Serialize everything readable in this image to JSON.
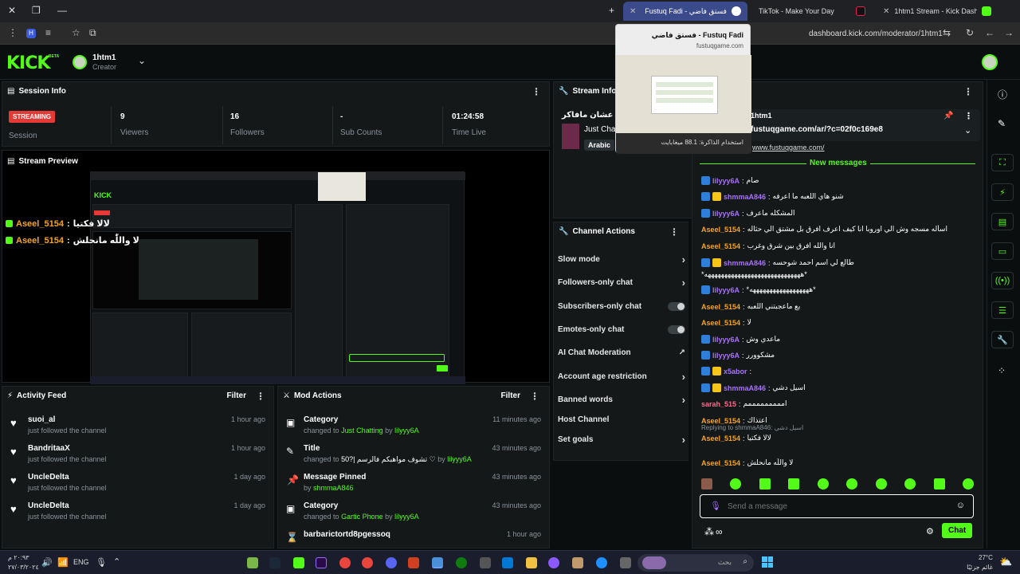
{
  "browser": {
    "tabs": [
      {
        "label": "فستق فاضي - Fustuq Fadi",
        "active": true
      },
      {
        "label": "TikTok - Make Your Day",
        "active": false
      },
      {
        "label": "1htm1 Stream - Kick Dashboard",
        "active": false
      }
    ],
    "url": "dashboard.kick.com/moderator/1htm1",
    "hover_card": {
      "title": "فستق فاضي - Fustuq Fadi",
      "domain": "fustuqgame.com",
      "memory": "استخدام الذاكرة: 88.1 ميغابايت"
    }
  },
  "header": {
    "logo": "KICK",
    "logo_beta": "BETA",
    "channel": "1htm1",
    "role": "Creator"
  },
  "session": {
    "title": "Session Info",
    "status": "STREAMING",
    "session_label": "Session",
    "stats": [
      {
        "value": "9",
        "label": "Viewers"
      },
      {
        "value": "16",
        "label": "Followers"
      },
      {
        "value": "-",
        "label": "Sub Counts"
      },
      {
        "value": "01:24:58",
        "label": "Time Live"
      }
    ]
  },
  "preview": {
    "title": "Stream Preview",
    "overlay": [
      {
        "user": "Aseel_5154",
        "text": "لالا فكتيا"
      },
      {
        "user": "Aseel_5154",
        "text": "لا واللّٰه مانحلش"
      }
    ]
  },
  "activity": {
    "title": "Activity Feed",
    "filter": "Filter",
    "items": [
      {
        "user": "suoi_al",
        "text": "just followed the channel",
        "time": "1 hour ago"
      },
      {
        "user": "BandritaaX",
        "text": "just followed the channel",
        "time": "1 hour ago"
      },
      {
        "user": "UncleDelta",
        "text": "just followed the channel",
        "time": "1 day ago"
      },
      {
        "user": "UncleDelta",
        "text": "just followed the channel",
        "time": "1 day ago"
      }
    ]
  },
  "mod": {
    "title": "Mod Actions",
    "filter": "Filter",
    "items": [
      {
        "action": "Category",
        "pre": "changed to",
        "target": "Just Chatting",
        "by": "by",
        "user": "lilyyy6A",
        "time": "11 minutes ago"
      },
      {
        "action": "Title",
        "pre": "changed to",
        "target": "50?| تشوف مواهبكم فالرسم ♡",
        "by": "by",
        "user": "lilyyy6A",
        "time": "43 minutes ago"
      },
      {
        "action": "Message Pinned",
        "pre": "",
        "target": "",
        "by": "by",
        "user": "shmmaA846",
        "time": "43 minutes ago"
      },
      {
        "action": "Category",
        "pre": "changed to",
        "target": "Gartic Phone",
        "by": "by",
        "user": "lilyyy6A",
        "time": "43 minutes ago"
      },
      {
        "action": "barbarictortd8pgessoq",
        "pre": "",
        "target": "",
        "by": "",
        "user": "",
        "time": "1 hour ago"
      }
    ]
  },
  "stream_info": {
    "title": "Stream Info",
    "stream_title": "ع وقت عشان مافاكر",
    "category": "Just Cha",
    "language": "Arabic"
  },
  "channel_actions": {
    "title": "Channel Actions",
    "items": [
      {
        "label": "Slow mode",
        "control": "chevron"
      },
      {
        "label": "Followers-only chat",
        "control": "chevron"
      },
      {
        "label": "Subscribers-only chat",
        "control": "toggle"
      },
      {
        "label": "Emotes-only chat",
        "control": "toggle"
      },
      {
        "label": "AI Chat Moderation",
        "control": "external"
      },
      {
        "label": "Account age restriction",
        "control": "chevron"
      },
      {
        "label": "Banned words",
        "control": "chevron"
      },
      {
        "label": "Host Channel",
        "control": "none"
      },
      {
        "label": "Set goals",
        "control": "chevron"
      }
    ]
  },
  "chat": {
    "pinned_user": "1htm1",
    "pinned_link": "fustuqgame.com/ar/?c=02f0c169e8",
    "pinned_link2": "www.fustuqgame.com/",
    "new_messages": "New messages",
    "messages": [
      {
        "user": "lilyyy6A",
        "color": "#a970ff",
        "badges": [
          "mod"
        ],
        "text": "صام"
      },
      {
        "user": "shmmaA846",
        "color": "#a970ff",
        "badges": [
          "mod",
          "crown"
        ],
        "text": "شنو هاي اللعبه ما اعرفه"
      },
      {
        "user": "lilyyy6A",
        "color": "#a970ff",
        "badges": [
          "mod"
        ],
        "text": "المشكله ماعرف"
      },
      {
        "user": "Aseel_5154",
        "color": "#f5a524",
        "badges": [],
        "text": "اسأله مسجه وش الي اوروبا انا كيف اعرف افرق بل مشتق الي حثاله"
      },
      {
        "user": "Aseel_5154",
        "color": "#f5a524",
        "badges": [],
        "text": "انا والله افرق بين شرق وغرب"
      },
      {
        "user": "shmmaA846",
        "color": "#a970ff",
        "badges": [
          "mod",
          "crown"
        ],
        "text": "طالع لي اسم احمد شوحسه"
      },
      {
        "user": "",
        "color": "#fff",
        "badges": [],
        "text": "*هههههههههههههههههههههههههههههه*"
      },
      {
        "user": "lilyyy6A",
        "color": "#a970ff",
        "badges": [
          "mod"
        ],
        "text": "*ههههههههههههههههههه*"
      },
      {
        "user": "Aseel_5154",
        "color": "#f5a524",
        "badges": [],
        "text": "بع ماعجبتني اللعبه"
      },
      {
        "user": "Aseel_5154",
        "color": "#f5a524",
        "badges": [],
        "text": "لا"
      },
      {
        "user": "lilyyy6A",
        "color": "#a970ff",
        "badges": [
          "mod"
        ],
        "text": "ماعدي وش"
      },
      {
        "user": "lilyyy6A",
        "color": "#a970ff",
        "badges": [
          "mod"
        ],
        "text": "مشكوورر"
      },
      {
        "user": "x5abor",
        "color": "#a970ff",
        "badges": [
          "mod",
          "crown"
        ],
        "text": ""
      },
      {
        "user": "shmmaA846",
        "color": "#a970ff",
        "badges": [
          "mod",
          "crown"
        ],
        "text": "اسيل دشي"
      },
      {
        "user": "sarah_515",
        "color": "#ff6a8a",
        "badges": [],
        "text": "امممممممممم"
      },
      {
        "user": "Aseel_5154",
        "color": "#f5a524",
        "badges": [],
        "text": "اعتذاك"
      },
      {
        "user": "Aseel_5154",
        "color": "#f5a524",
        "badges": [],
        "text": "لالا فكتيا",
        "reply": "Replying to shmmaA846: اسيل دشي"
      },
      {
        "user": "Aseel_5154",
        "color": "#f5a524",
        "badges": [],
        "text": "لا واللّٰه مانحلش"
      }
    ],
    "placeholder": "Send a message",
    "send_label": "Chat"
  },
  "taskbar": {
    "time": "٢٠:٩٣ م",
    "date": "٢٧/٠٣/٢٠٢٤",
    "lang": "ENG",
    "search_placeholder": "بحث",
    "weather_temp": "27°C",
    "weather_desc": "غائم جزئيًا"
  },
  "colors": {
    "accent": "#53fc18",
    "streaming": "#e53935",
    "bg": "#0b0e0f",
    "panel": "#141819"
  }
}
